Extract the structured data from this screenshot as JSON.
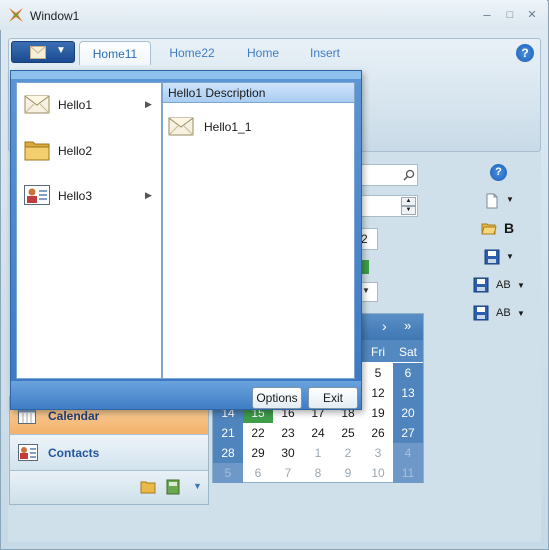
{
  "window": {
    "title": "Window1",
    "controls": {
      "minimize": "–",
      "maximize": "□",
      "close": "✕"
    }
  },
  "ribbon": {
    "tabs": [
      {
        "label": "Home11"
      },
      {
        "label": "Home22"
      },
      {
        "label": "Home"
      },
      {
        "label": "Insert"
      }
    ],
    "help": "?"
  },
  "popup": {
    "menu_items": [
      {
        "label": "Hello1",
        "icon": "envelope-icon"
      },
      {
        "label": "Hello2",
        "icon": "folder-icon"
      },
      {
        "label": "Hello3",
        "icon": "contact-card-icon"
      }
    ],
    "description_header": "Hello1 Description",
    "sub_items": [
      {
        "label": "Hello1_1",
        "icon": "envelope-icon"
      }
    ],
    "options_label": "Options",
    "exit_label": "Exit"
  },
  "background": {
    "spinner_value": "2",
    "nav": {
      "calendar_label": "Calendar",
      "contacts_label": "Contacts"
    },
    "calendar": {
      "nav_next": "›",
      "nav_next_far": "»",
      "days_of_week": [
        "Fri",
        "Sat"
      ],
      "rows": [
        [
          "",
          "",
          "",
          "",
          "",
          "5",
          "6"
        ],
        [
          "",
          "",
          "",
          "",
          "",
          "12",
          "13"
        ],
        [
          "14",
          "15",
          "16",
          "17",
          "18",
          "19",
          "20"
        ],
        [
          "21",
          "22",
          "23",
          "24",
          "25",
          "26",
          "27"
        ],
        [
          "28",
          "29",
          "30",
          "1",
          "2",
          "3",
          "4"
        ],
        [
          "5",
          "6",
          "7",
          "8",
          "9",
          "10",
          "11"
        ]
      ]
    },
    "right_toolbar": {
      "bold_label": "B",
      "ab1_label": "AB",
      "ab2_label": "AB"
    }
  },
  "colors": {
    "accent": "#3f78b5",
    "today": "#3f9d4a",
    "nav_selected": "#f4b16a"
  }
}
